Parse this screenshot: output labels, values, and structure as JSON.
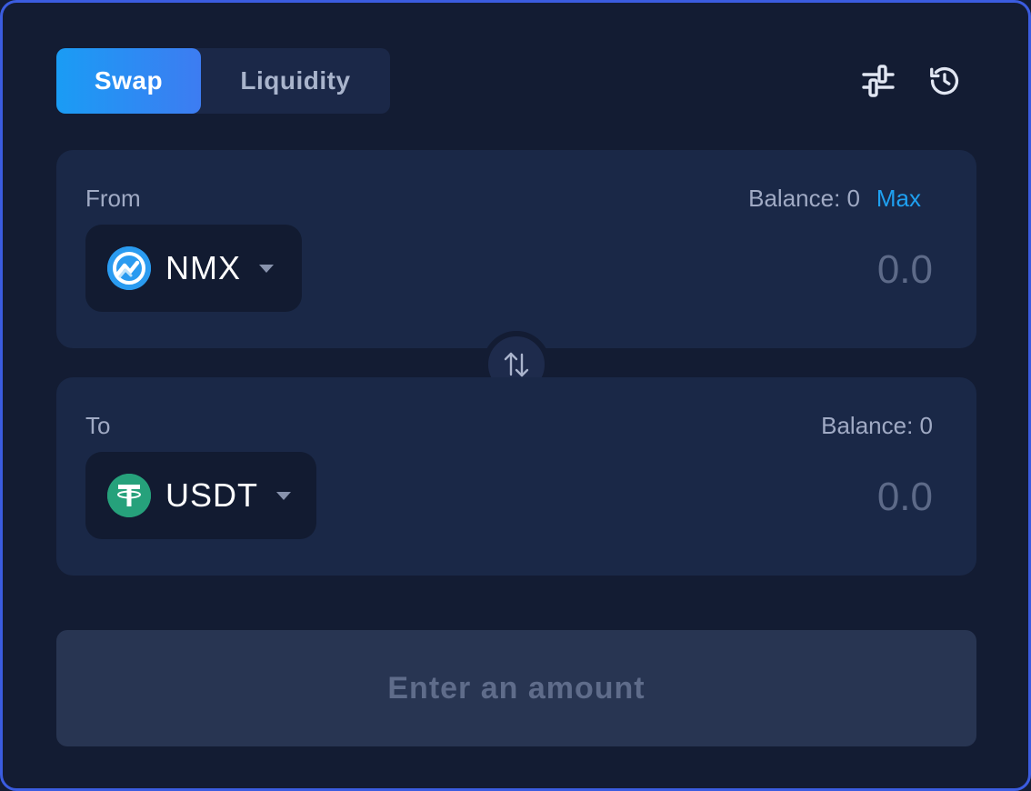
{
  "tabs": [
    {
      "label": "Swap",
      "active": true
    },
    {
      "label": "Liquidity",
      "active": false
    }
  ],
  "header_icons": [
    "settings-sliders-icon",
    "history-icon"
  ],
  "from": {
    "label": "From",
    "balance_text": "Balance: 0",
    "max_label": "Max",
    "token": {
      "symbol": "NMX",
      "icon": "nmx-logo-icon",
      "color": "#2a9bf0"
    },
    "amount_placeholder": "0.0"
  },
  "to": {
    "label": "To",
    "balance_text": "Balance: 0",
    "token": {
      "symbol": "USDT",
      "icon": "usdt-logo-icon",
      "color": "#26a17b"
    },
    "amount_placeholder": "0.0"
  },
  "swap_direction_icon": "swap-vertical-arrows-icon",
  "submit": {
    "label": "Enter an amount",
    "disabled": true
  },
  "colors": {
    "background": "#131c33",
    "panel": "#1a2847",
    "accent": "#1fa0f0",
    "border": "#3b5ce0"
  }
}
